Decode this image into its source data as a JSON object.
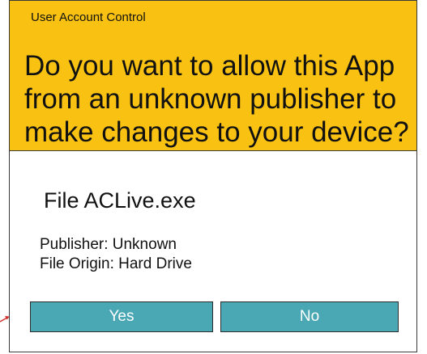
{
  "dialog": {
    "title": "User Account Control",
    "question": "Do you want to allow this App from an unknown publisher to make changes to your device?",
    "file_name": "File ACLive.exe",
    "publisher": "Publisher: Unknown",
    "file_origin": "File Origin: Hard Drive",
    "yes_label": "Yes",
    "no_label": "No"
  },
  "colors": {
    "banner": "#f9c112",
    "button": "#4aa7b4",
    "arrow": "#d0312d"
  },
  "icons": [
    "red-pointer-arrow-icon"
  ]
}
